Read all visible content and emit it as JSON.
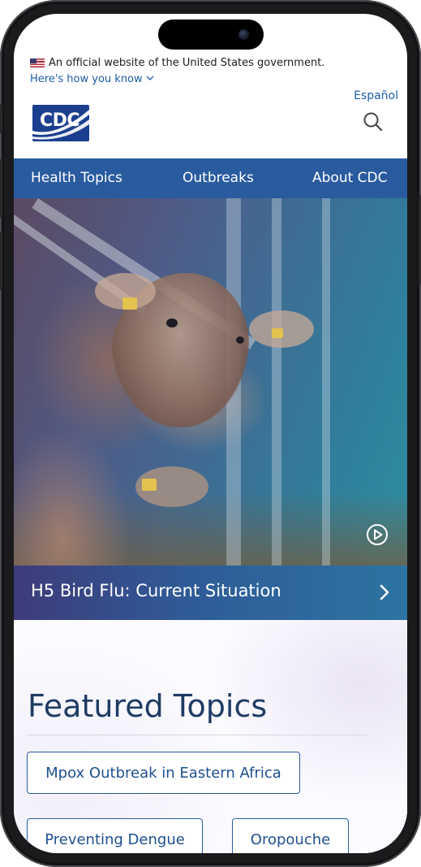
{
  "gov_banner": {
    "official_text": "An official website of the United States government.",
    "how_you_know": "Here's how you know"
  },
  "header": {
    "language_link": "Español",
    "logo_text": "CDC",
    "search_icon": "search-icon"
  },
  "nav": {
    "items": [
      {
        "label": "Health Topics"
      },
      {
        "label": "Outbreaks"
      },
      {
        "label": "About CDC"
      }
    ]
  },
  "hero": {
    "title": "H5 Bird Flu: Current Situation",
    "play_icon": "play-circle-icon",
    "chevron_icon": "chevron-right-icon"
  },
  "featured": {
    "title": "Featured Topics",
    "topics": [
      {
        "label": "Mpox Outbreak in Eastern Africa"
      },
      {
        "label": "Preventing Dengue"
      },
      {
        "label": "Oropouche"
      }
    ]
  },
  "colors": {
    "nav_bg": "#2a5b9f",
    "link": "#1e5ca8",
    "heading": "#1f3b64",
    "logo_bg": "#1b3f8e"
  }
}
